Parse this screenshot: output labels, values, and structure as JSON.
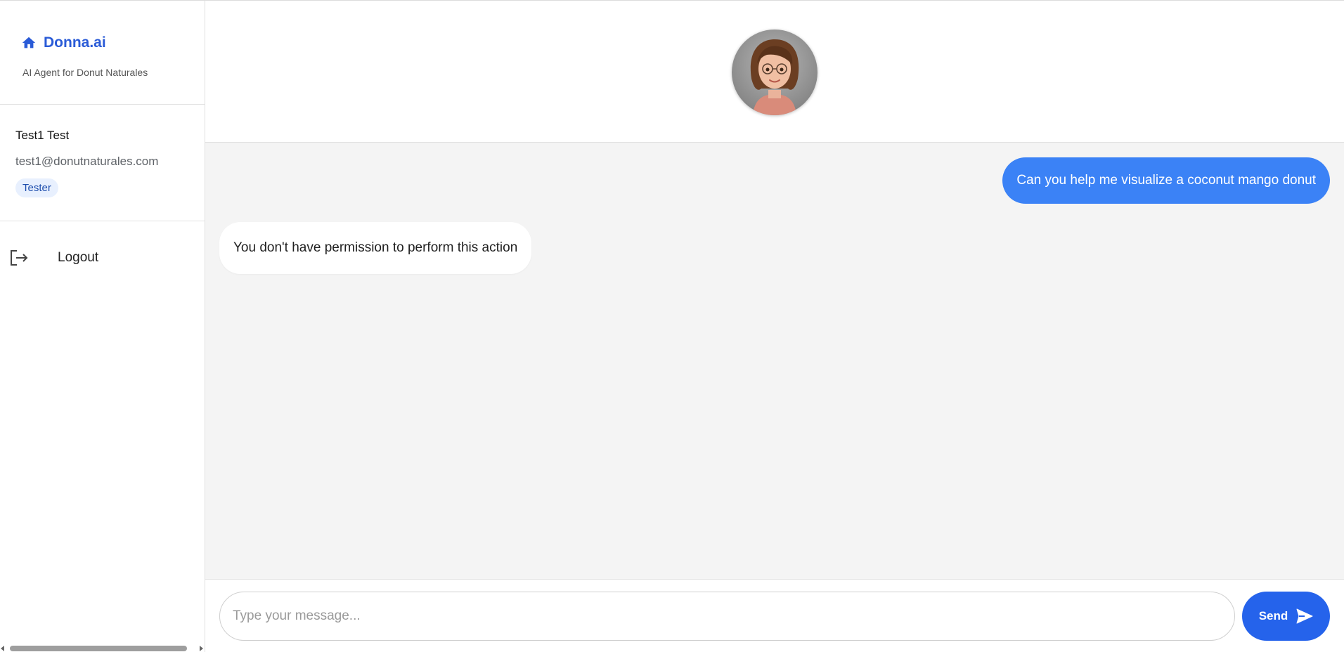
{
  "sidebar": {
    "brand": {
      "title": "Donna.ai",
      "subtitle": "AI Agent for Donut Naturales",
      "icon": "home-icon",
      "color": "#2a5bd7"
    },
    "user": {
      "name": "Test1 Test",
      "email": "test1@donutnaturales.com",
      "role": "Tester"
    },
    "logout": {
      "label": "Logout",
      "icon": "logout-icon"
    }
  },
  "chat": {
    "avatar": "assistant-avatar",
    "messages": [
      {
        "role": "user",
        "text": "Can you help me visualize a coconut mango donut"
      },
      {
        "role": "assistant",
        "text": "You don't have permission to perform this action"
      }
    ]
  },
  "composer": {
    "placeholder": "Type your message...",
    "value": "",
    "send_label": "Send",
    "send_icon": "send-icon",
    "accent": "#2563eb"
  }
}
